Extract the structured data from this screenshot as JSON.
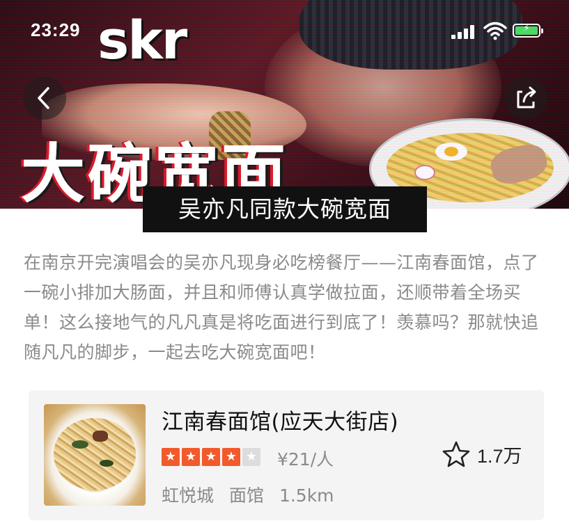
{
  "status_bar": {
    "time": "23:29"
  },
  "hero": {
    "skr_text": "skr",
    "title_overlay": "大碗宽面",
    "caption": "吴亦凡同款大碗宽面"
  },
  "article": {
    "description": "在南京开完演唱会的吴亦凡现身必吃榜餐厅——江南春面馆，点了一碗小排加大肠面，并且和师傅认真学做拉面，还顺带着全场买单！这么接地气的凡凡真是将吃面进行到底了！羡慕吗？那就快追随凡凡的脚步，一起去吃大碗宽面吧！"
  },
  "shop_card": {
    "name": "江南春面馆(应天大街店)",
    "rating": 4,
    "rating_max": 5,
    "price": "¥21/人",
    "area": "虹悦城",
    "category": "面馆",
    "distance": "1.5km",
    "favorite_count": "1.7万"
  },
  "colors": {
    "star_on": "#f25a2b",
    "star_off": "#dcdcdc",
    "caption_bg": "#111111",
    "card_bg": "#f4f4f4"
  },
  "icons": {
    "back": "chevron-left-icon",
    "share": "share-icon",
    "favorite": "star-outline-icon"
  }
}
